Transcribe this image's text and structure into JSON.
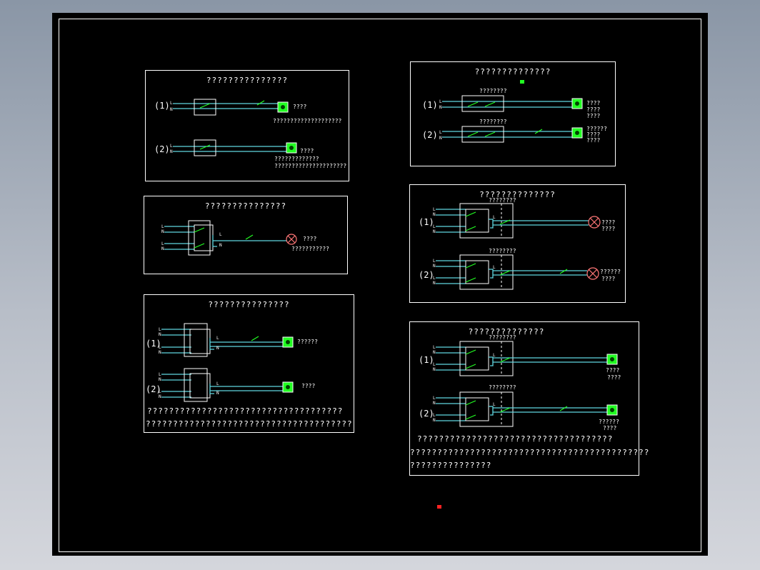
{
  "colors": {
    "background": "#000000",
    "wire": "#5fd7e0",
    "switch": "#22ff22",
    "lamp": "#22ff22",
    "bulb": "#ff7777",
    "marker_green": "#22ff22",
    "marker_red": "#ff2222"
  },
  "icons": [
    "switch-box-icon",
    "lamp-icon",
    "bulb-icon"
  ],
  "panel_a": {
    "title": "???????????????",
    "row1_num": "(1)",
    "row1_lamp": "????",
    "row1_caption": "????????????????????",
    "row2_num": "(2)",
    "row2_lamp": "????",
    "row2_caption1": "?????????????",
    "row2_caption2": "?????????????????????",
    "L": "L",
    "N": "N"
  },
  "panel_b": {
    "title": "???????????????",
    "lamp": "????",
    "caption": "???????????",
    "L": "L",
    "N": "N"
  },
  "panel_c": {
    "title": "???????????????",
    "row1_num": "(1)",
    "row1_lamp": "??????",
    "row2_num": "(2)",
    "row2_lamp": "????",
    "note1": "????????????????????????????????????",
    "note2": "??????????????????????????????????????",
    "L": "L",
    "N": "N"
  },
  "panel_d": {
    "title": "??????????????",
    "row1_num": "(1)",
    "row1_box": "????????",
    "row1_lamp1": "????",
    "row1_lamp2": "????",
    "row1_lamp3": "????",
    "row2_num": "(2)",
    "row2_box": "????????",
    "row2_lamp1": "??????",
    "row2_lamp2": "????",
    "row2_lamp3": "????",
    "L": "L",
    "N": "N"
  },
  "panel_e": {
    "title": "??????????????",
    "row1_num": "(1)",
    "row1_box": "????????",
    "row1_lamp1": "????",
    "row1_lamp2": "????",
    "row2_num": "(2)",
    "row2_box": "????????",
    "row2_lamp1": "??????",
    "row2_lamp2": "????",
    "L": "L",
    "N": "N"
  },
  "panel_f": {
    "title": "??????????????",
    "row1_num": "(1)",
    "row1_box": "????????",
    "row1_lamp1": "????",
    "row1_lamp2": "????",
    "row2_num": "(2)",
    "row2_box": "????????",
    "row2_lamp1": "??????",
    "row2_lamp2": "????",
    "note1": "????????????????????????????????????",
    "note2": "????????????????????????????????????????????",
    "note3": "???????????????",
    "L": "L",
    "N": "N"
  }
}
